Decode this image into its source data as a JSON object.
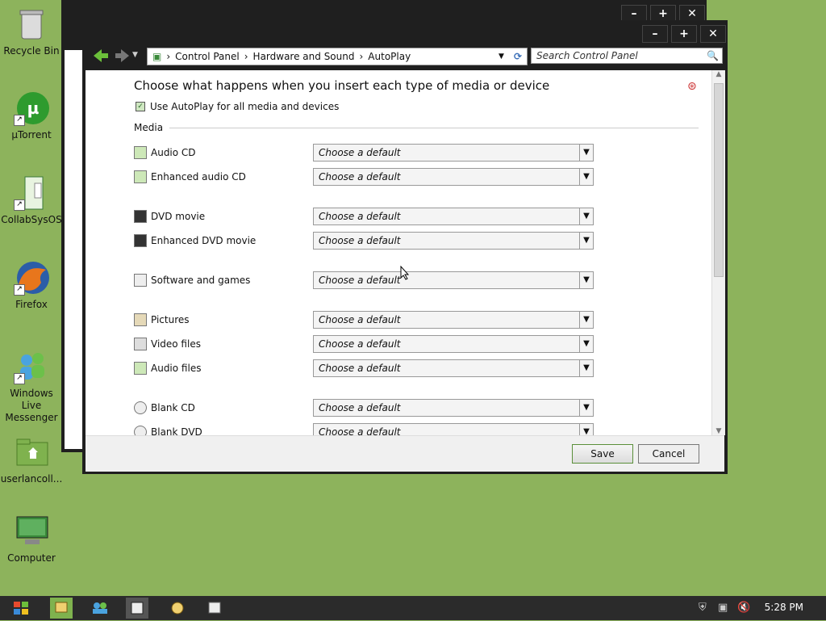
{
  "desktop": {
    "icons": [
      {
        "label": "Recycle Bin"
      },
      {
        "label": "µTorrent"
      },
      {
        "label": "CollabSysOS"
      },
      {
        "label": "Firefox"
      },
      {
        "label": "Windows Live Messenger"
      },
      {
        "label": "userlancoll..."
      },
      {
        "label": "Computer"
      }
    ]
  },
  "window": {
    "breadcrumb": [
      "Control Panel",
      "Hardware and Sound",
      "AutoPlay"
    ],
    "search_placeholder": "Search Control Panel",
    "heading": "Choose what happens when you insert each type of media or device",
    "autoplay_checkbox": "Use AutoPlay for all media and devices",
    "section_media": "Media",
    "rows": [
      {
        "label": "Audio CD",
        "value": "Choose a default"
      },
      {
        "label": "Enhanced audio CD",
        "value": "Choose a default"
      },
      {
        "label": "DVD movie",
        "value": "Choose a default"
      },
      {
        "label": "Enhanced DVD movie",
        "value": "Choose a default"
      },
      {
        "label": "Software and games",
        "value": "Choose a default"
      },
      {
        "label": "Pictures",
        "value": "Choose a default"
      },
      {
        "label": "Video files",
        "value": "Choose a default"
      },
      {
        "label": "Audio files",
        "value": "Choose a default"
      },
      {
        "label": "Blank CD",
        "value": "Choose a default"
      },
      {
        "label": "Blank DVD",
        "value": "Choose a default"
      }
    ],
    "save_label": "Save",
    "cancel_label": "Cancel"
  },
  "taskbar": {
    "clock": "5:28 PM"
  }
}
